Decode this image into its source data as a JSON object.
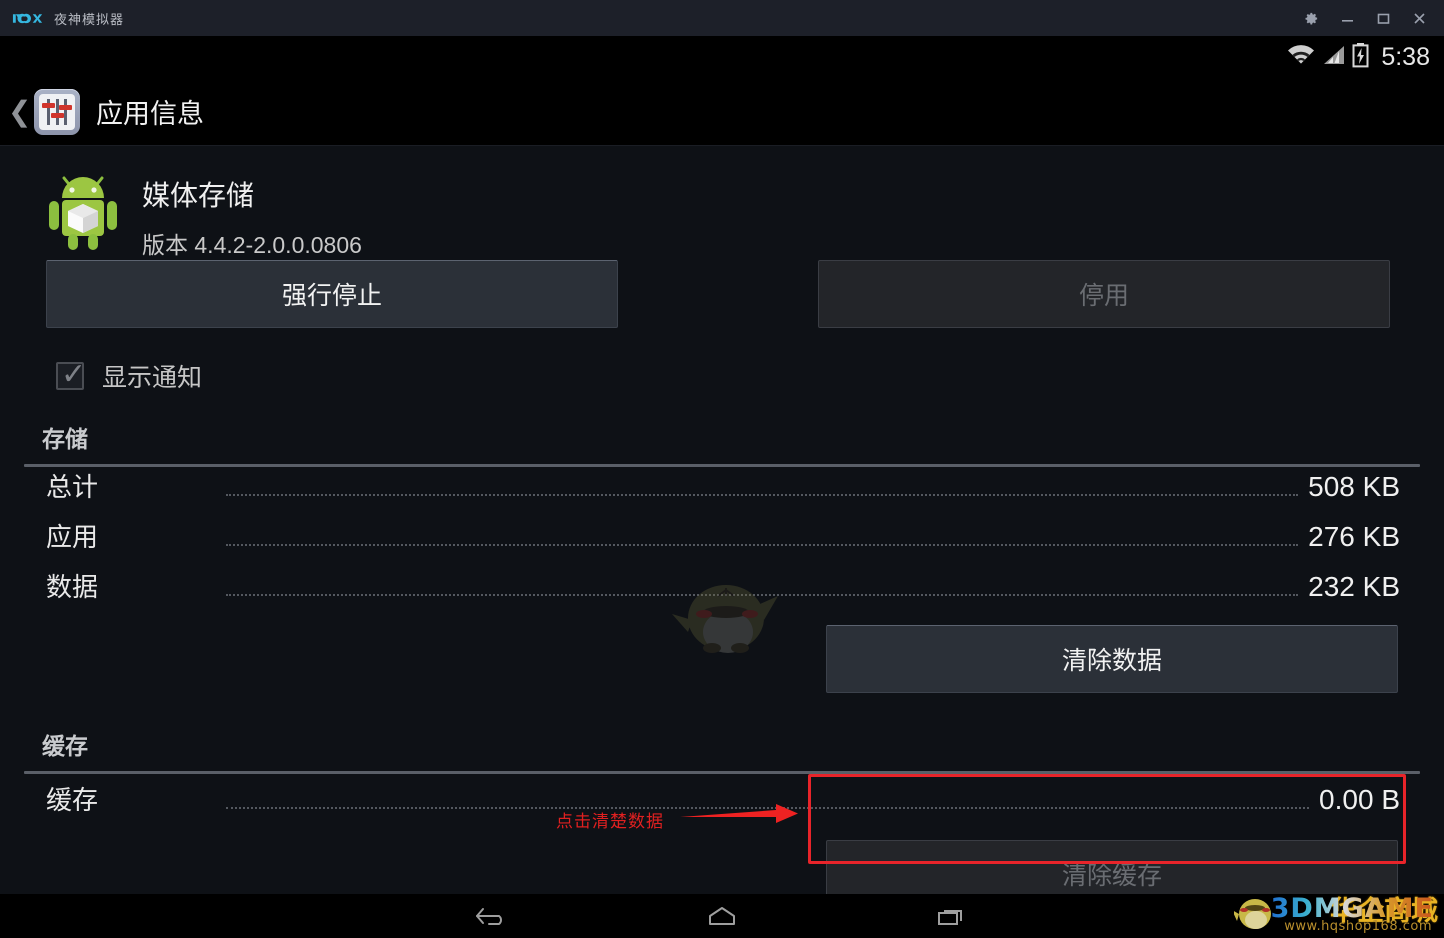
{
  "window": {
    "brand_logo": "nox-logo",
    "brand_mark": "nox",
    "title": "夜神模拟器",
    "controls": [
      {
        "name": "settings-gear",
        "label": "设置"
      },
      {
        "name": "minimize",
        "label": "最小化"
      },
      {
        "name": "maximize",
        "label": "最大化"
      },
      {
        "name": "close",
        "label": "关闭"
      }
    ]
  },
  "statusbar": {
    "wifi_icon": "wifi-icon",
    "signal_icon": "cellular-signal-icon",
    "battery_icon": "battery-charging-icon",
    "time": "5:38"
  },
  "actionbar": {
    "up_icon": "back-chevron-icon",
    "app_icon": "settings-sliders-icon",
    "title": "应用信息"
  },
  "app": {
    "icon": "android-robot-icon",
    "name": "媒体存储",
    "version": "版本 4.4.2-2.0.0.0806"
  },
  "buttons": {
    "force_stop": {
      "label": "强行停止",
      "enabled": true
    },
    "disable": {
      "label": "停用",
      "enabled": false
    },
    "clear_data": {
      "label": "清除数据",
      "enabled": true
    },
    "clear_cache": {
      "label": "清除缓存",
      "enabled": false
    }
  },
  "notifications": {
    "label": "显示通知",
    "checked": true
  },
  "storage": {
    "section_title": "存储",
    "rows": [
      {
        "label": "总计",
        "value": "508 KB"
      },
      {
        "label": "应用",
        "value": "276 KB"
      },
      {
        "label": "数据",
        "value": "232 KB"
      }
    ]
  },
  "cache": {
    "section_title": "缓存",
    "rows": [
      {
        "label": "缓存",
        "value": "0.00 B"
      }
    ]
  },
  "annotation": {
    "text": "点击清楚数据",
    "color": "#e02020",
    "arrow_icon": "right-arrow-icon",
    "highlight_color": "#e8242a"
  },
  "navbar": {
    "back_icon": "nav-back-icon",
    "home_icon": "nav-home-icon",
    "recents_icon": "nav-recents-icon"
  },
  "watermarks": {
    "mascot_icon": "bird-mascot-watermark",
    "brand_cn": "华企商城",
    "brand_en": "3DMGAME",
    "url": "www.hqshop168.com"
  }
}
